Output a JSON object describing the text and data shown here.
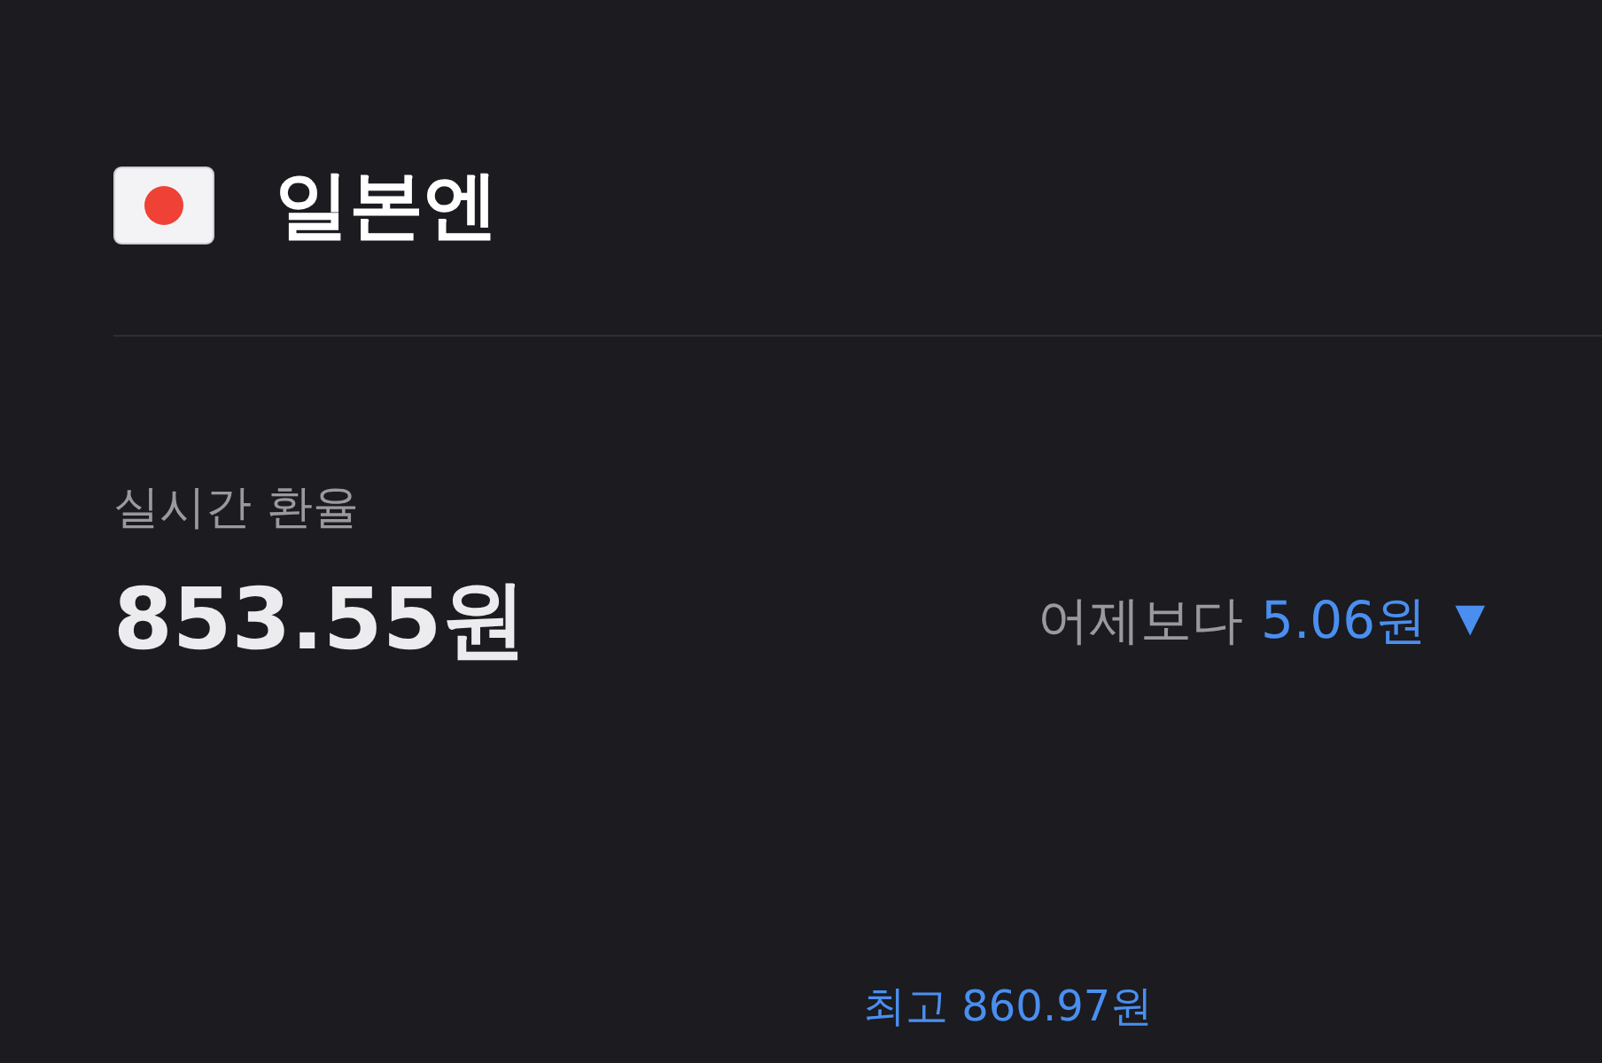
{
  "currency": {
    "name": "일본엔"
  },
  "rate": {
    "label": "실시간 환율",
    "value": "853.55원",
    "change_label": "어제보다",
    "change_value": "5.06원",
    "falling": true,
    "direction_icon": "▼"
  },
  "chart": {
    "high_label": "최고 860.97원"
  }
}
